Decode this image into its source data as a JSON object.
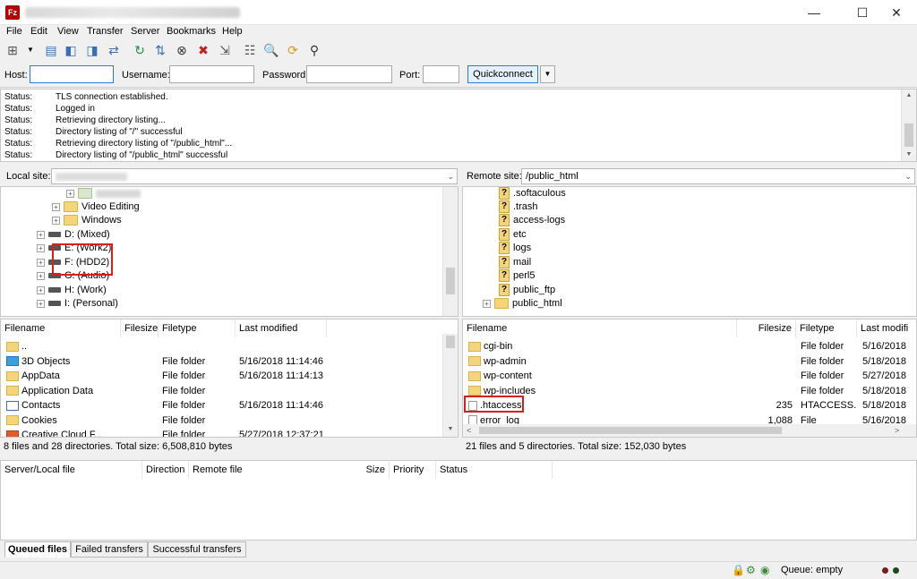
{
  "window": {
    "app_icon_text": "Fz",
    "minimize": "—",
    "maximize": "☐",
    "close": "✕"
  },
  "menu": [
    "File",
    "Edit",
    "View",
    "Transfer",
    "Server",
    "Bookmarks",
    "Help"
  ],
  "quickconnect": {
    "host_label": "Host:",
    "host_value": "",
    "username_label": "Username:",
    "username_value": "",
    "password_label": "Password:",
    "password_value": "",
    "port_label": "Port:",
    "port_value": "",
    "button_label": "Quickconnect",
    "dropdown": "▼"
  },
  "log": [
    {
      "status": "Status:",
      "message": "TLS connection established."
    },
    {
      "status": "Status:",
      "message": "Logged in"
    },
    {
      "status": "Status:",
      "message": "Retrieving directory listing..."
    },
    {
      "status": "Status:",
      "message": "Directory listing of \"/\" successful"
    },
    {
      "status": "Status:",
      "message": "Retrieving directory listing of \"/public_html\"..."
    },
    {
      "status": "Status:",
      "message": "Directory listing of \"/public_html\" successful"
    }
  ],
  "local": {
    "site_label": "Local site:",
    "path": "",
    "tree": [
      {
        "label": "",
        "kind": "folder",
        "level": 3
      },
      {
        "label": "Video Editing",
        "kind": "folder",
        "level": 3
      },
      {
        "label": "Windows",
        "kind": "folder",
        "level": 3
      },
      {
        "label": "D: (Mixed)",
        "kind": "drive",
        "level": 2
      },
      {
        "label": "E: (Work2)",
        "kind": "drive",
        "level": 2
      },
      {
        "label": "F: (HDD2)",
        "kind": "drive",
        "level": 2
      },
      {
        "label": "G: (Audio)",
        "kind": "drive",
        "level": 2
      },
      {
        "label": "H: (Work)",
        "kind": "drive",
        "level": 2
      },
      {
        "label": "I: (Personal)",
        "kind": "drive",
        "level": 2
      }
    ],
    "columns": {
      "filename": "Filename",
      "filesize": "Filesize",
      "filetype": "Filetype",
      "modified": "Last modified"
    },
    "files": [
      {
        "name": "..",
        "size": "",
        "type": "",
        "modified": "",
        "icon": "folder"
      },
      {
        "name": "3D Objects",
        "size": "",
        "type": "File folder",
        "modified": "5/16/2018 11:14:46",
        "icon": "blue"
      },
      {
        "name": "AppData",
        "size": "",
        "type": "File folder",
        "modified": "5/16/2018 11:14:13",
        "icon": "folder"
      },
      {
        "name": "Application Data",
        "size": "",
        "type": "File folder",
        "modified": "",
        "icon": "folder"
      },
      {
        "name": "Contacts",
        "size": "",
        "type": "File folder",
        "modified": "5/16/2018 11:14:46",
        "icon": "contact"
      },
      {
        "name": "Cookies",
        "size": "",
        "type": "File folder",
        "modified": "",
        "icon": "folder"
      },
      {
        "name": "Creative Cloud F...",
        "size": "",
        "type": "File folder",
        "modified": "5/27/2018 12:37:21",
        "icon": "cloud"
      }
    ],
    "summary": "8 files and 28 directories. Total size: 6,508,810 bytes"
  },
  "remote": {
    "site_label": "Remote site:",
    "path": "/public_html",
    "tree": [
      {
        "label": ".softaculous"
      },
      {
        "label": ".trash"
      },
      {
        "label": "access-logs"
      },
      {
        "label": "etc"
      },
      {
        "label": "logs"
      },
      {
        "label": "mail"
      },
      {
        "label": "perl5"
      },
      {
        "label": "public_ftp"
      },
      {
        "label": "public_html"
      }
    ],
    "columns": {
      "filename": "Filename",
      "filesize": "Filesize",
      "filetype": "Filetype",
      "modified": "Last modifi"
    },
    "files": [
      {
        "name": "cgi-bin",
        "size": "",
        "type": "File folder",
        "modified": "5/16/2018",
        "icon": "folder"
      },
      {
        "name": "wp-admin",
        "size": "",
        "type": "File folder",
        "modified": "5/18/2018",
        "icon": "folder"
      },
      {
        "name": "wp-content",
        "size": "",
        "type": "File folder",
        "modified": "5/27/2018",
        "icon": "folder"
      },
      {
        "name": "wp-includes",
        "size": "",
        "type": "File folder",
        "modified": "5/18/2018",
        "icon": "folder"
      },
      {
        "name": ".htaccess",
        "size": "235",
        "type": "HTACCESS...",
        "modified": "5/18/2018",
        "icon": "doc"
      },
      {
        "name": "error_log",
        "size": "1,088",
        "type": "File",
        "modified": "5/16/2018",
        "icon": "doc"
      }
    ],
    "summary": "21 files and 5 directories. Total size: 152,030 bytes"
  },
  "queue": {
    "columns": [
      "Server/Local file",
      "Direction",
      "Remote file",
      "Size",
      "Priority",
      "Status"
    ],
    "tabs": [
      "Queued files",
      "Failed transfers",
      "Successful transfers"
    ]
  },
  "statusbar": {
    "queue": "Queue: empty"
  },
  "colors": {
    "highlight": "#d61f1f",
    "folder": "#f5d57a"
  }
}
